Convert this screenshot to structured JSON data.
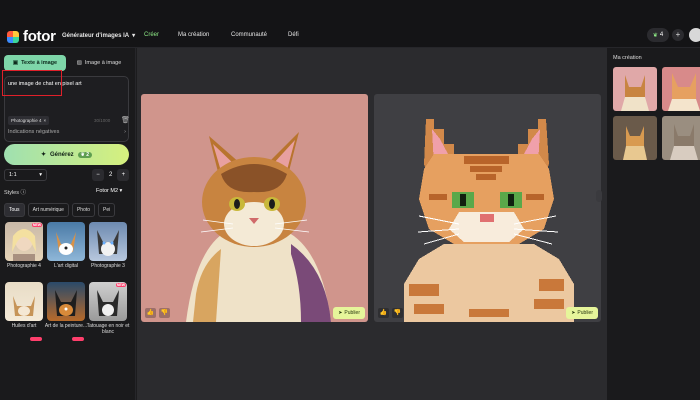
{
  "header": {
    "logo_text": "fotor",
    "nav": [
      {
        "label": "Générateur d'images IA"
      },
      {
        "label": "Créer"
      },
      {
        "label": "Ma création"
      },
      {
        "label": "Communauté"
      },
      {
        "label": "Défi"
      }
    ],
    "credits": "4"
  },
  "left": {
    "tabs": [
      {
        "label": "Texte à image"
      },
      {
        "label": "Image à image"
      }
    ],
    "prompt": {
      "value": "une image de chat en pixel art"
    },
    "chip": "Photographie 4",
    "counter": "30/1000",
    "negative_label": "Indications négatives",
    "generate_label": "Générez",
    "generate_cost": "2",
    "ratio": "1:1",
    "count": "2",
    "styles_label": "Styles",
    "model_label": "Fotor M2",
    "style_pills": [
      "Tous",
      "Art numérique",
      "Photo",
      "Pei"
    ],
    "style_tiles": [
      {
        "label": "Photographie 4",
        "badge": "NEW"
      },
      {
        "label": "L'art digital"
      },
      {
        "label": "Photographie 3"
      },
      {
        "label": "Huiles d'art"
      },
      {
        "label": "Art de la peinture..."
      },
      {
        "label": "Tatouage en noir et blanc",
        "badge": "NEW"
      }
    ]
  },
  "results": [
    {
      "publish_label": "Publier"
    },
    {
      "publish_label": "Publier"
    }
  ],
  "right": {
    "title": "Ma création"
  },
  "colors": {
    "accent_green": "#8eea86",
    "generate_gradient_start": "#9fe0b0",
    "generate_gradient_end": "#d6f07e",
    "badge_new": "#ff3f6c"
  }
}
